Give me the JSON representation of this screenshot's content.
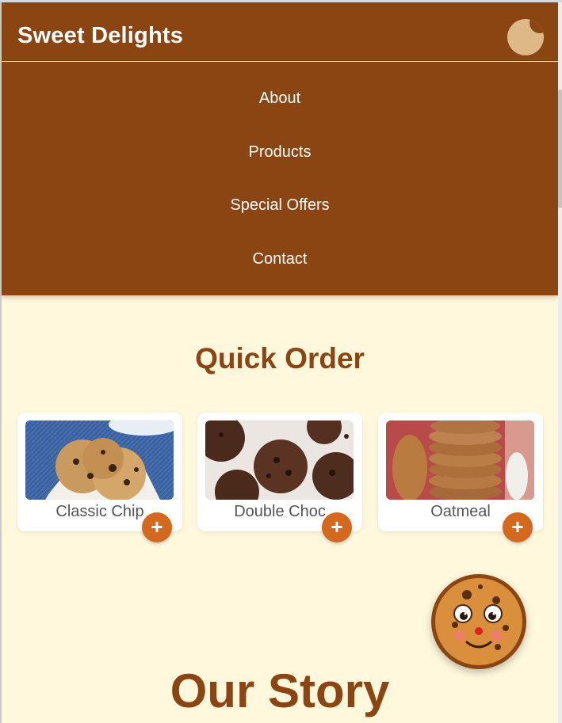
{
  "header": {
    "brand": "Sweet Delights",
    "theme_toggle_icon": "cookie-moon-icon"
  },
  "menu": {
    "items": [
      {
        "label": "About"
      },
      {
        "label": "Products"
      },
      {
        "label": "Special Offers"
      },
      {
        "label": "Contact"
      }
    ]
  },
  "quick_order": {
    "title": "Quick Order",
    "products": [
      {
        "name": "Classic Chip",
        "add_label": "+"
      },
      {
        "name": "Double Choc",
        "add_label": "+"
      },
      {
        "name": "Oatmeal",
        "add_label": "+"
      }
    ]
  },
  "story": {
    "title": "Our Story"
  },
  "colors": {
    "brand_brown": "#8b4513",
    "accent_orange": "#d2691e",
    "cream_background": "#fff8dc",
    "tan": "#deb887"
  },
  "mascot": {
    "icon": "smiling-cookie-icon"
  }
}
